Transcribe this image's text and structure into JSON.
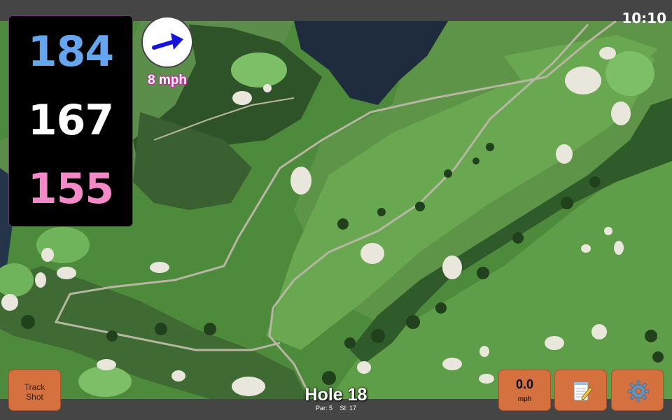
{
  "status": {
    "time": "10:10"
  },
  "distances": {
    "back": "184",
    "middle": "167",
    "front": "155"
  },
  "colors": {
    "back": "#66a6ef",
    "middle": "#ffffff",
    "front": "#f38ac7",
    "button": "#d4713f",
    "wind_arrow": "#1414dd"
  },
  "wind": {
    "speed_label": "8 mph",
    "direction_icon": "arrow-up-right-icon"
  },
  "hole": {
    "title": "Hole 18",
    "par": "Par: 5",
    "stroke_index": "SI: 17"
  },
  "buttons": {
    "track_shot_line1": "Track",
    "track_shot_line2": "Shot",
    "speed_value": "0.0",
    "speed_unit": "mph",
    "notes_icon": "notepad-icon",
    "settings_icon": "gear-icon"
  }
}
